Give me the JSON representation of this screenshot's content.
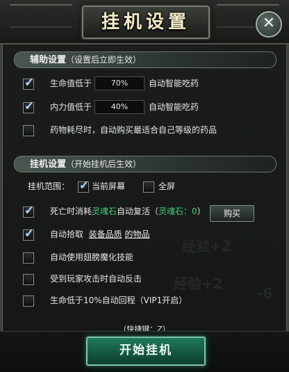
{
  "window": {
    "title": "挂机设置",
    "close_icon": "close-icon"
  },
  "assist": {
    "title": "辅助设置",
    "subtitle": "（设置后立即生效）",
    "rows": [
      {
        "checked": true,
        "label": "生命值低于",
        "value": "70%",
        "suffix": "自动智能吃药"
      },
      {
        "checked": true,
        "label": "内力值低于",
        "value": "40%",
        "suffix": "自动智能吃药"
      },
      {
        "checked": false,
        "label": "药物耗尽时，自动购买最适合自己等级的药品"
      }
    ]
  },
  "hangup": {
    "title": "挂机设置",
    "subtitle": "（开始挂机后生效）",
    "range_label": "挂机范围：",
    "range_current": {
      "checked": true,
      "label": "当前屏幕"
    },
    "range_full": {
      "checked": false,
      "label": "全屏"
    },
    "revive": {
      "checked": true,
      "prefix": "死亡时消耗",
      "item": "灵魂石",
      "middle": "自动复活（",
      "count_label": "灵魂石：0",
      "close": "）",
      "buy_label": "购买"
    },
    "pickup": {
      "checked": true,
      "prefix": "自动拾取",
      "link1": "装备品质",
      "link2": "的物品"
    },
    "skill": {
      "checked": false,
      "label": "自动使用翅膀魔化技能"
    },
    "counter": {
      "checked": false,
      "label": "受到玩家攻击时自动反击"
    },
    "vip": {
      "checked": false,
      "label": "生命低于10%自动回程（VIP1开启）"
    }
  },
  "footer": {
    "shortcut": "（快捷键：Z）",
    "start_label": "开始挂机"
  }
}
